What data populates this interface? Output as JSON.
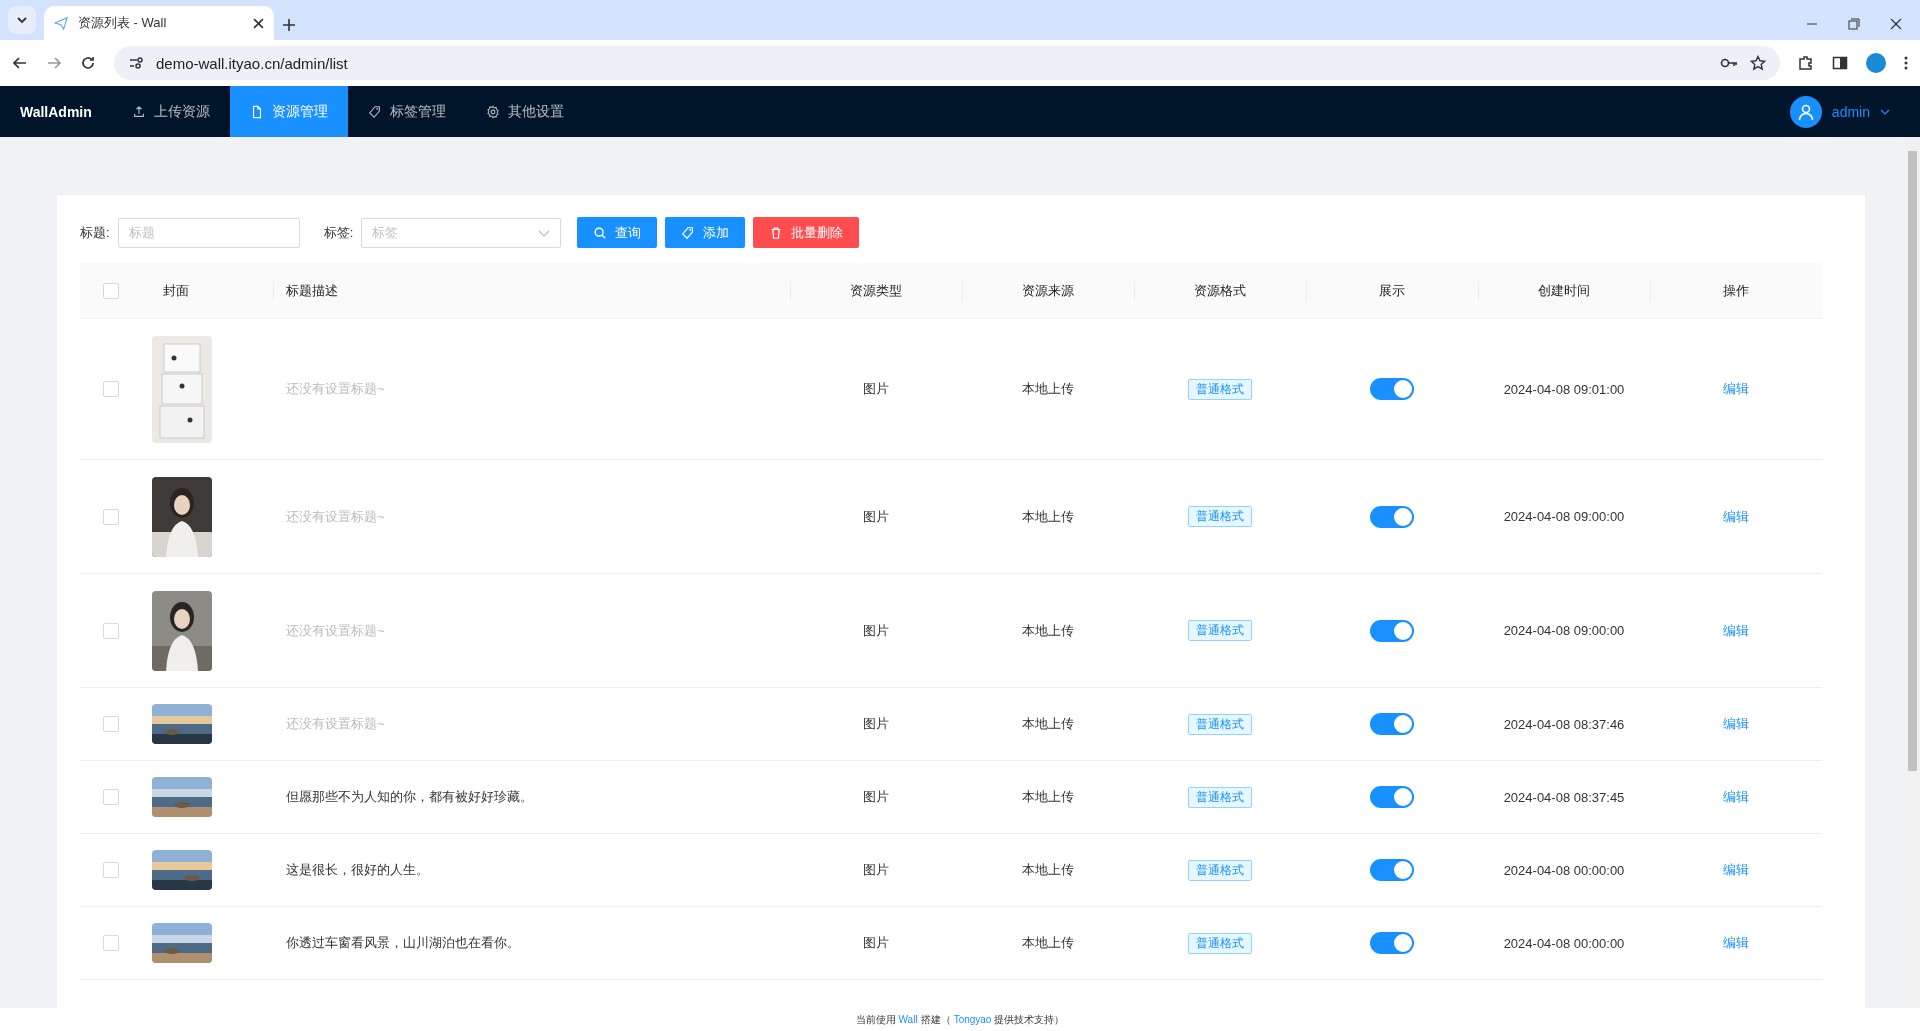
{
  "browser": {
    "tab_title": "资源列表 - Wall",
    "url": "demo-wall.ityao.cn/admin/list"
  },
  "nav": {
    "brand": "WallAdmin",
    "items": [
      {
        "label": "上传资源",
        "selected": false
      },
      {
        "label": "资源管理",
        "selected": true
      },
      {
        "label": "标签管理",
        "selected": false
      },
      {
        "label": "其他设置",
        "selected": false
      }
    ],
    "user": "admin"
  },
  "filters": {
    "title_label": "标题:",
    "title_placeholder": "标题",
    "tag_label": "标签:",
    "tag_placeholder": "标签",
    "buttons": [
      {
        "label": "查询",
        "kind": "search"
      },
      {
        "label": "添加",
        "kind": "add"
      },
      {
        "label": "批量删除",
        "kind": "delete"
      }
    ]
  },
  "table": {
    "header_checked": false,
    "columns": [
      "封面",
      "标题描述",
      "资源类型",
      "资源来源",
      "资源格式",
      "展示",
      "创建时间",
      "操作"
    ],
    "rows": [
      {
        "checked": false,
        "title": "还没有设置标题~",
        "untitled": true,
        "type": "图片",
        "source": "本地上传",
        "format": "普通格式",
        "shown": true,
        "created": "2024-04-08 09:01:00",
        "action": "编辑"
      },
      {
        "checked": false,
        "title": "还没有设置标题~",
        "untitled": true,
        "type": "图片",
        "source": "本地上传",
        "format": "普通格式",
        "shown": true,
        "created": "2024-04-08 09:00:00",
        "action": "编辑"
      },
      {
        "checked": false,
        "title": "还没有设置标题~",
        "untitled": true,
        "type": "图片",
        "source": "本地上传",
        "format": "普通格式",
        "shown": true,
        "created": "2024-04-08 09:00:00",
        "action": "编辑"
      },
      {
        "checked": false,
        "title": "还没有设置标题~",
        "untitled": true,
        "type": "图片",
        "source": "本地上传",
        "format": "普通格式",
        "shown": true,
        "created": "2024-04-08 08:37:46",
        "action": "编辑"
      },
      {
        "checked": false,
        "title": "但愿那些不为人知的你，都有被好好珍藏。",
        "untitled": false,
        "type": "图片",
        "source": "本地上传",
        "format": "普通格式",
        "shown": true,
        "created": "2024-04-08 08:37:45",
        "action": "编辑"
      },
      {
        "checked": false,
        "title": "这是很长，很好的人生。",
        "untitled": false,
        "type": "图片",
        "source": "本地上传",
        "format": "普通格式",
        "shown": true,
        "created": "2024-04-08 00:00:00",
        "action": "编辑"
      },
      {
        "checked": false,
        "title": "你透过车窗看风景，山川湖泊也在看你。",
        "untitled": false,
        "type": "图片",
        "source": "本地上传",
        "format": "普通格式",
        "shown": true,
        "created": "2024-04-08 00:00:00",
        "action": "编辑"
      }
    ]
  },
  "footer": [
    {
      "text": "当前使用",
      "kind": "text"
    },
    {
      "text": "Wall",
      "kind": "link"
    },
    {
      "text": "搭建（",
      "kind": "text"
    },
    {
      "text": "Tongyao",
      "kind": "link"
    },
    {
      "text": "提供技术支持）",
      "kind": "text"
    }
  ]
}
